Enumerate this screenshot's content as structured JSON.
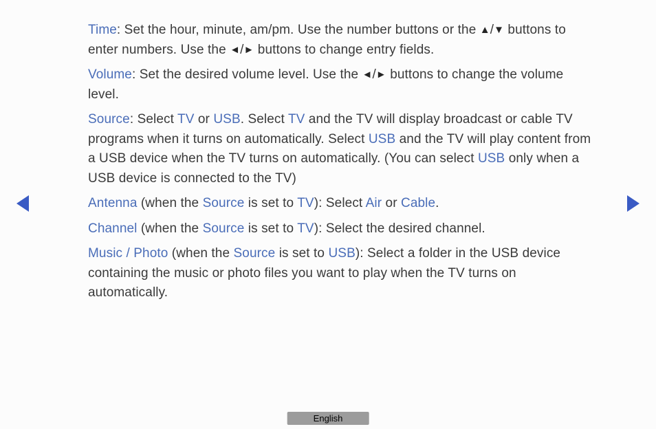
{
  "items": {
    "time": {
      "label": "Time",
      "text1": ": Set the hour, minute, am/pm. Use the number buttons or the ",
      "text2": " buttons to enter numbers. Use the ",
      "text3": " buttons to change entry fields."
    },
    "volume": {
      "label": "Volume",
      "text1": ": Set the desired volume level. Use the ",
      "text2": " buttons to change the volume level."
    },
    "source": {
      "label": "Source",
      "text1": ": Select ",
      "kw1": "TV",
      "text2": " or ",
      "kw2": "USB",
      "text3": ". Select ",
      "kw3": "TV",
      "text4": " and the TV will display broadcast or cable TV programs when it turns on automatically. Select ",
      "kw4": "USB",
      "text5": " and the TV will play content from a USB device when the TV turns on automatically. (You can select ",
      "kw5": "USB",
      "text6": " only when a USB device is connected to the TV)"
    },
    "antenna": {
      "label": "Antenna",
      "text1": " (when the ",
      "kw1": "Source",
      "text2": " is set to ",
      "kw2": "TV",
      "text3": "): Select ",
      "kw3": "Air",
      "text4": " or ",
      "kw4": "Cable",
      "text5": "."
    },
    "channel": {
      "label": "Channel",
      "text1": " (when the ",
      "kw1": "Source",
      "text2": " is set to ",
      "kw2": "TV",
      "text3": "): Select the desired channel."
    },
    "music": {
      "label": "Music / Photo",
      "text1": " (when the ",
      "kw1": "Source",
      "text2": " is set to ",
      "kw2": "USB",
      "text3": "): Select a folder in the USB device containing the music or photo files you want to play when the TV turns on automatically."
    }
  },
  "glyphs": {
    "up": "▲",
    "down": "▼",
    "left": "◄",
    "right": "►",
    "slash": "/"
  },
  "footer": {
    "language": "English"
  }
}
